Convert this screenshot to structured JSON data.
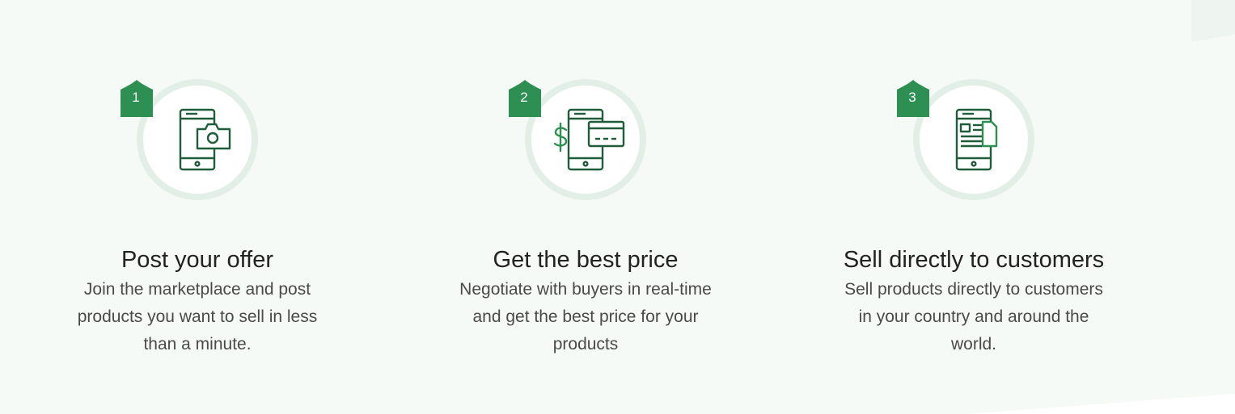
{
  "steps": [
    {
      "number": "1",
      "icon": "phone-camera-icon",
      "title": "Post your offer",
      "description": "Join the marketplace and post products you want to sell in less than a minute."
    },
    {
      "number": "2",
      "icon": "phone-payment-icon",
      "title": "Get the best price",
      "description": "Negotiate with buyers in real-time and get the best price for your products"
    },
    {
      "number": "3",
      "icon": "phone-catalog-icon",
      "title": "Sell directly to customers",
      "description": "Sell products directly to customers in your country and around the world."
    }
  ],
  "colors": {
    "accent": "#2d8f52",
    "icon_stroke": "#1e5c3a",
    "ring": "#e2efe6",
    "background": "#f6faf7"
  }
}
